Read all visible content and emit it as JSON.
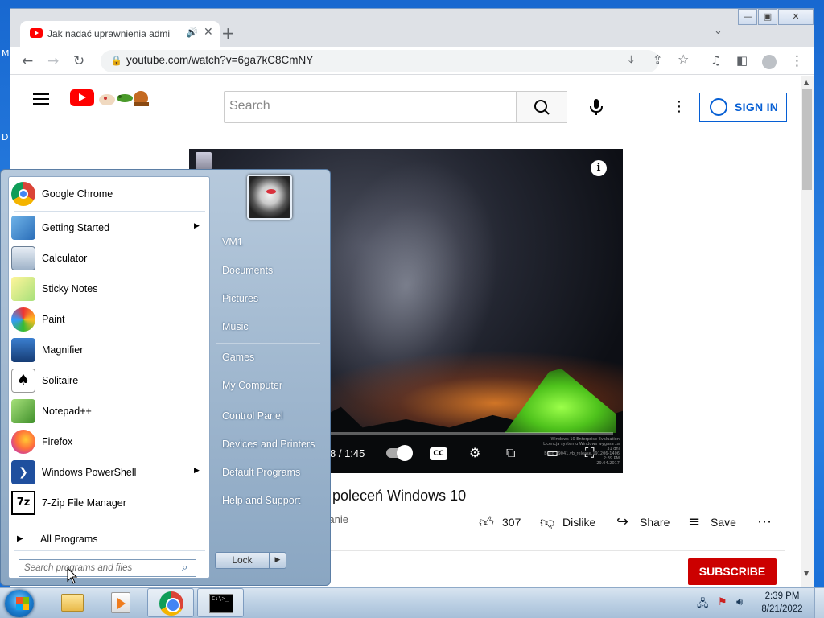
{
  "desktop": {
    "letter_m": "M",
    "letter_d": "D"
  },
  "browser": {
    "tab_title": "Jak nadać uprawnienia admi",
    "tab_audio_glyph": "🔊",
    "tab_close_glyph": "✕",
    "new_tab_glyph": "+",
    "tab_dropdown_glyph": "⌄",
    "url": "youtube.com/watch?v=6ga7kC8CmNY",
    "window_controls": {
      "minimize": "—",
      "maximize": "▣",
      "close": "✕"
    }
  },
  "youtube": {
    "search_placeholder": "Search",
    "sign_in_label": "SIGN IN",
    "video": {
      "time": "8 / 1:45",
      "cc_label": "CC",
      "info_glyph": "i",
      "watermark": [
        "Windows 10 Enterprise Evaluation",
        "Licencja systemu Windows wygasa za 31 dni",
        "Build 19041.vb_release.191206-1406",
        "2:39 PM",
        "29.04.2017"
      ]
    },
    "title_fragment": "z poleceń Windows 10",
    "channel_fragment": "wanie",
    "likes": "307",
    "dislike_label": "Dislike",
    "share_label": "Share",
    "save_label": "Save",
    "subscribe_label": "SUBSCRIBE"
  },
  "start_menu": {
    "programs": [
      {
        "label": "Google Chrome",
        "icon": "chrome-icon",
        "arrow": false
      },
      {
        "label": "Getting Started",
        "icon": "getting-started-icon",
        "arrow": true
      },
      {
        "label": "Calculator",
        "icon": "calculator-icon",
        "arrow": false
      },
      {
        "label": "Sticky Notes",
        "icon": "sticky-notes-icon",
        "arrow": false
      },
      {
        "label": "Paint",
        "icon": "paint-icon",
        "arrow": false
      },
      {
        "label": "Magnifier",
        "icon": "magnifier-icon",
        "arrow": false
      },
      {
        "label": "Solitaire",
        "icon": "solitaire-icon",
        "arrow": false
      },
      {
        "label": "Notepad++",
        "icon": "notepadpp-icon",
        "arrow": false
      },
      {
        "label": "Firefox",
        "icon": "firefox-icon",
        "arrow": false
      },
      {
        "label": "Windows PowerShell",
        "icon": "powershell-icon",
        "arrow": true
      },
      {
        "label": "7-Zip File Manager",
        "icon": "7zip-icon",
        "arrow": false
      }
    ],
    "all_programs": "All Programs",
    "search_placeholder": "Search programs and files",
    "right_items": [
      "VM1",
      "Documents",
      "Pictures",
      "Music",
      "Games",
      "My Computer",
      "Control Panel",
      "Devices and Printers",
      "Default Programs",
      "Help and Support"
    ],
    "lock_label": "Lock"
  },
  "taskbar": {
    "time": "2:39 PM",
    "date": "8/21/2022",
    "cmd_text": "C:\\>_"
  }
}
